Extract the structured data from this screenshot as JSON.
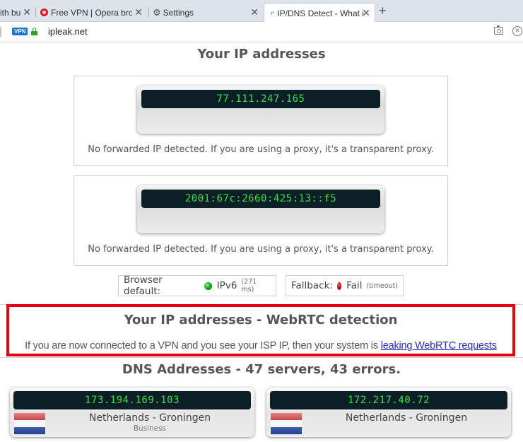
{
  "browser": {
    "tabs": [
      {
        "label": "ith bu",
        "close": "✕"
      },
      {
        "label": "Free VPN | Opera browser",
        "close": "✕",
        "icon": "opera-logo-icon"
      },
      {
        "label": "Settings",
        "close": "✕",
        "icon": "gear-icon"
      },
      {
        "label": "IP/DNS Detect - What is yo",
        "close": "✕",
        "icon": "ipleak-favicon",
        "active": true
      }
    ],
    "new_tab": "+",
    "vpn_badge": "VPN",
    "url": "ipleak.net",
    "address_bar_icons": [
      "camera-snapshot-icon",
      "close-circle-icon"
    ]
  },
  "page": {
    "ip_section": {
      "title": "Your IP addresses",
      "entries": [
        {
          "ip": "77.111.247.165",
          "note": "No forwarded IP detected. If you are using a proxy, it's a transparent proxy."
        },
        {
          "ip": "2001:67c:2660:425:13::f5",
          "note": "No forwarded IP detected. If you are using a proxy, it's a transparent proxy."
        }
      ]
    },
    "connectivity": {
      "browser_default": {
        "label": "Browser default:",
        "value": "IPv6",
        "detail": "(271 ms)",
        "status_color": "#0c9a0c"
      },
      "fallback": {
        "label": "Fallback:",
        "value": "Fail",
        "detail": "(timeout)",
        "status_color": "#b80000"
      }
    },
    "webrtc": {
      "title": "Your IP addresses - WebRTC detection",
      "text": "If you are now connected to a VPN and you see your ISP IP, then your system is ",
      "link": "leaking WebRTC requests",
      "highlight_color": "#e8000e"
    },
    "dns": {
      "title": "DNS Addresses - 47 servers, 43 errors.",
      "servers": [
        {
          "ip": "173.194.169.103",
          "location": "Netherlands - Groningen",
          "type": "Business"
        },
        {
          "ip": "172.217.40.72",
          "location": "Netherlands - Groningen",
          "type": ""
        }
      ]
    }
  }
}
